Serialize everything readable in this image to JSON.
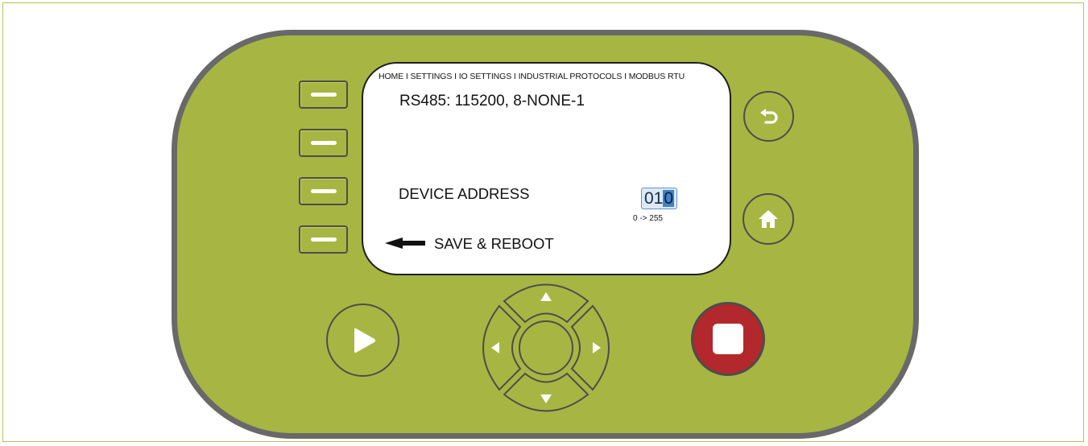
{
  "screen": {
    "breadcrumb": "HOME I SETTINGS I IO SETTINGS I INDUSTRIAL PROTOCOLS I MODBUS RTU",
    "rs485": "RS485: 115200, 8-NONE-1",
    "device_address": {
      "label": "DEVICE ADDRESS",
      "value_prefix": "01",
      "value_selected": "0",
      "range": "0 -> 255"
    },
    "save_label": "SAVE & REBOOT"
  },
  "controls": {
    "softkeys": [
      "softkey-1",
      "softkey-2",
      "softkey-3",
      "softkey-4"
    ],
    "back_icon": "back-arrow-icon",
    "home_icon": "home-icon",
    "play_icon": "play-icon",
    "stop_icon": "stop-icon",
    "dpad_icons": [
      "up-arrow-icon",
      "down-arrow-icon",
      "left-arrow-icon",
      "right-arrow-icon"
    ]
  },
  "colors": {
    "body": "#a7b642",
    "bezel": "#696969",
    "stop": "#b3282c",
    "selection": "#3d84c6"
  }
}
